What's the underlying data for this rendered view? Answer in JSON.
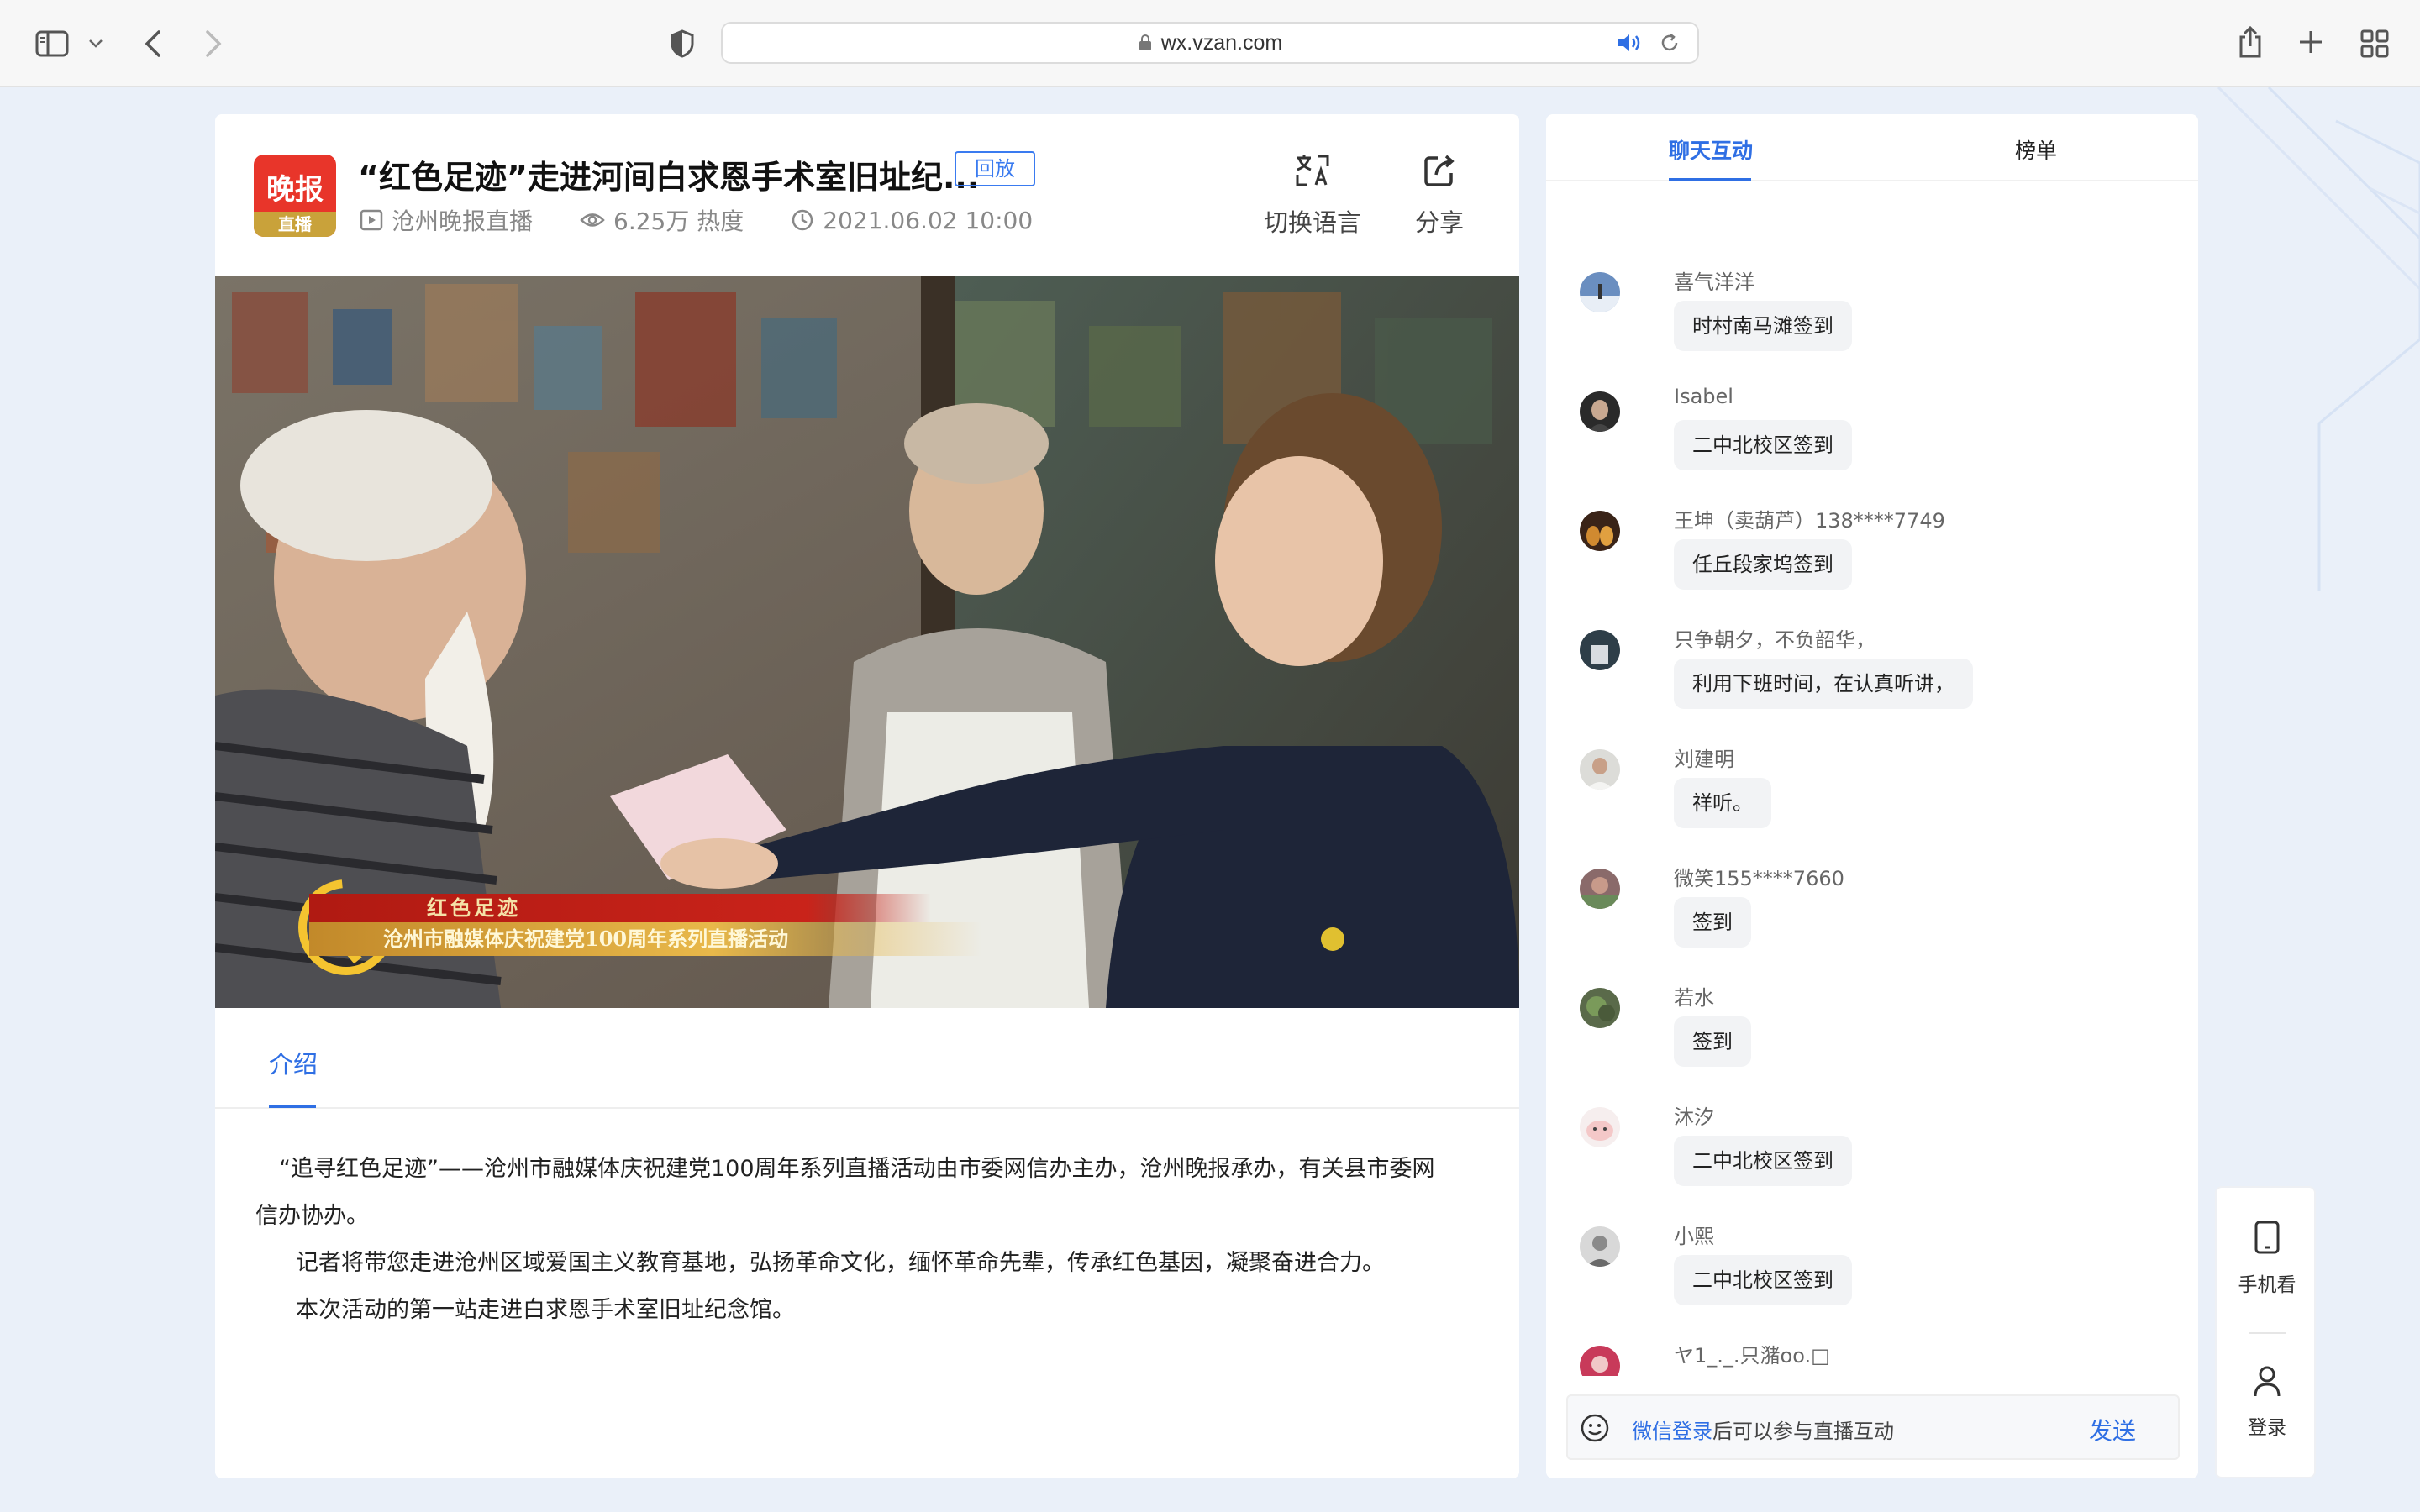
{
  "browser": {
    "url": "wx.vzan.com"
  },
  "header": {
    "logo_top": "晚报",
    "logo_bottom": "直播",
    "title": "“红色足迹”走进河间白求恩手术室旧址纪...",
    "badge": "回放",
    "channel": "沧州晚报直播",
    "views": "6.25万 热度",
    "datetime": "2021.06.02 10:00",
    "actions": {
      "translate_label": "切换语言",
      "share_label": "分享"
    }
  },
  "video": {
    "banner_line1": "红色足迹",
    "banner_line2": "沧州市融媒体庆祝建党100周年系列直播活动"
  },
  "tabs": {
    "intro": "介绍"
  },
  "intro": {
    "p1": "“追寻红色足迹”——沧州市融媒体庆祝建党100周年系列直播活动由市委网信办主办，沧州晚报承办，有关县市委网信办协办。",
    "p2": "记者将带您走进沧州区域爱国主义教育基地，弘扬革命文化，缅怀革命先辈，传承红色基因，凝聚奋进合力。",
    "p3": "本次活动的第一站走进白求恩手术室旧址纪念馆。"
  },
  "chat": {
    "tabs": [
      "聊天互动",
      "榜单"
    ],
    "messages": [
      {
        "name": "喜气洋洋",
        "text": "时村南马滩签到"
      },
      {
        "name": "Isabel",
        "text": "二中北校区签到"
      },
      {
        "name": "王坤（卖葫芦）138****7749",
        "text": "任丘段家坞签到"
      },
      {
        "name": "只争朝夕，不负韶华，",
        "text": "利用下班时间，在认真听讲，"
      },
      {
        "name": "刘建明",
        "text": "祥听。"
      },
      {
        "name": "微笑155****7660",
        "text": "签到"
      },
      {
        "name": "若水",
        "text": "签到"
      },
      {
        "name": "沐汐",
        "text": "二中北校区签到"
      },
      {
        "name": "小熙",
        "text": "二中北校区签到"
      },
      {
        "name": "ヤ1_._.只潴oo.□",
        "text": ""
      }
    ],
    "input": {
      "login_link": "微信登录",
      "prompt": "后可以参与直播互动",
      "send": "发送"
    }
  },
  "floatbar": {
    "mobile_label": "手机看",
    "login_label": "登录"
  },
  "colors": {
    "accent": "#2f6fe4",
    "logo_red": "#e8352a",
    "page_bg": "#eaf0f9"
  }
}
